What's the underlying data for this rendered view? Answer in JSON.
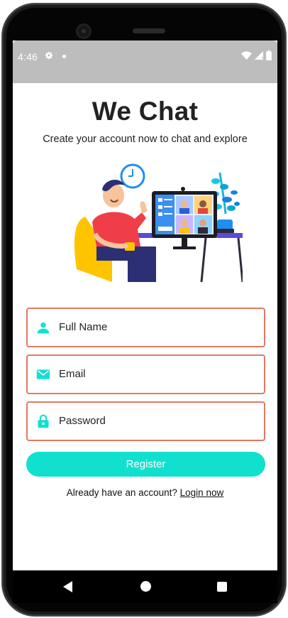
{
  "status_bar": {
    "time": "4:46",
    "icons": [
      "gear-icon",
      "dot-icon",
      "wifi-icon",
      "signal-icon",
      "battery-icon"
    ]
  },
  "header": {
    "title": "We Chat",
    "subtitle": "Create your account now to chat and explore"
  },
  "form": {
    "full_name": {
      "placeholder": "Full Name",
      "icon": "person-icon"
    },
    "email": {
      "placeholder": "Email",
      "icon": "mail-icon"
    },
    "password": {
      "placeholder": "Password",
      "icon": "lock-icon"
    },
    "register_label": "Register"
  },
  "footer": {
    "prompt": "Already have an account?",
    "login_label": "Login now"
  },
  "colors": {
    "accent": "#12e0cf",
    "field_border": "#e07a62",
    "status_bar": "#bdbdbd"
  },
  "nav": {
    "buttons": [
      "back-icon",
      "home-icon",
      "recents-icon"
    ]
  }
}
